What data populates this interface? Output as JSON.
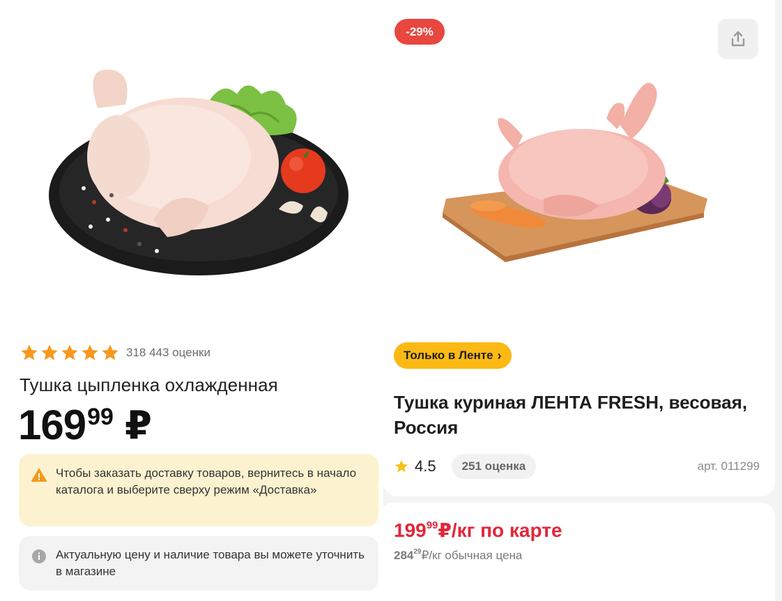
{
  "left_product": {
    "rating_count": "318 443 оценки",
    "stars": 5,
    "title": "Тушка цыпленка охлажденная",
    "price_rub": "169",
    "price_kop": "99",
    "currency": "₽",
    "delivery_notice": "Чтобы заказать доставку товаров, вернитесь в начало каталога и выберите сверху режим «Доставка»",
    "store_notice": "Актуальную цену и наличие товара вы можете уточнить в магазине",
    "image_icon": "whole-chicken-on-slate-photo"
  },
  "right_product": {
    "discount_badge": "-29%",
    "share_icon": "share-icon",
    "image_icon": "raw-chicken-on-board-photo",
    "exclusive_badge": "Только в Ленте",
    "exclusive_chevron": "›",
    "title": "Тушка куриная ЛЕНТА FRESH, весовая, Россия",
    "rating": "4.5",
    "rating_count": "251 оценка",
    "article": "арт. 011299",
    "card_price_rub": "199",
    "card_price_kop": "99",
    "card_price_suffix": "₽/кг по карте",
    "regular_price_rub": "284",
    "regular_price_kop": "29",
    "regular_price_suffix": "₽/кг обычная цена"
  },
  "colors": {
    "star": "#f8981d",
    "discount": "#e8473f",
    "exclusive": "#fcb913",
    "card_price": "#e2273a",
    "warning_bg": "#fdf2d0",
    "info_bg": "#f3f3f4"
  }
}
